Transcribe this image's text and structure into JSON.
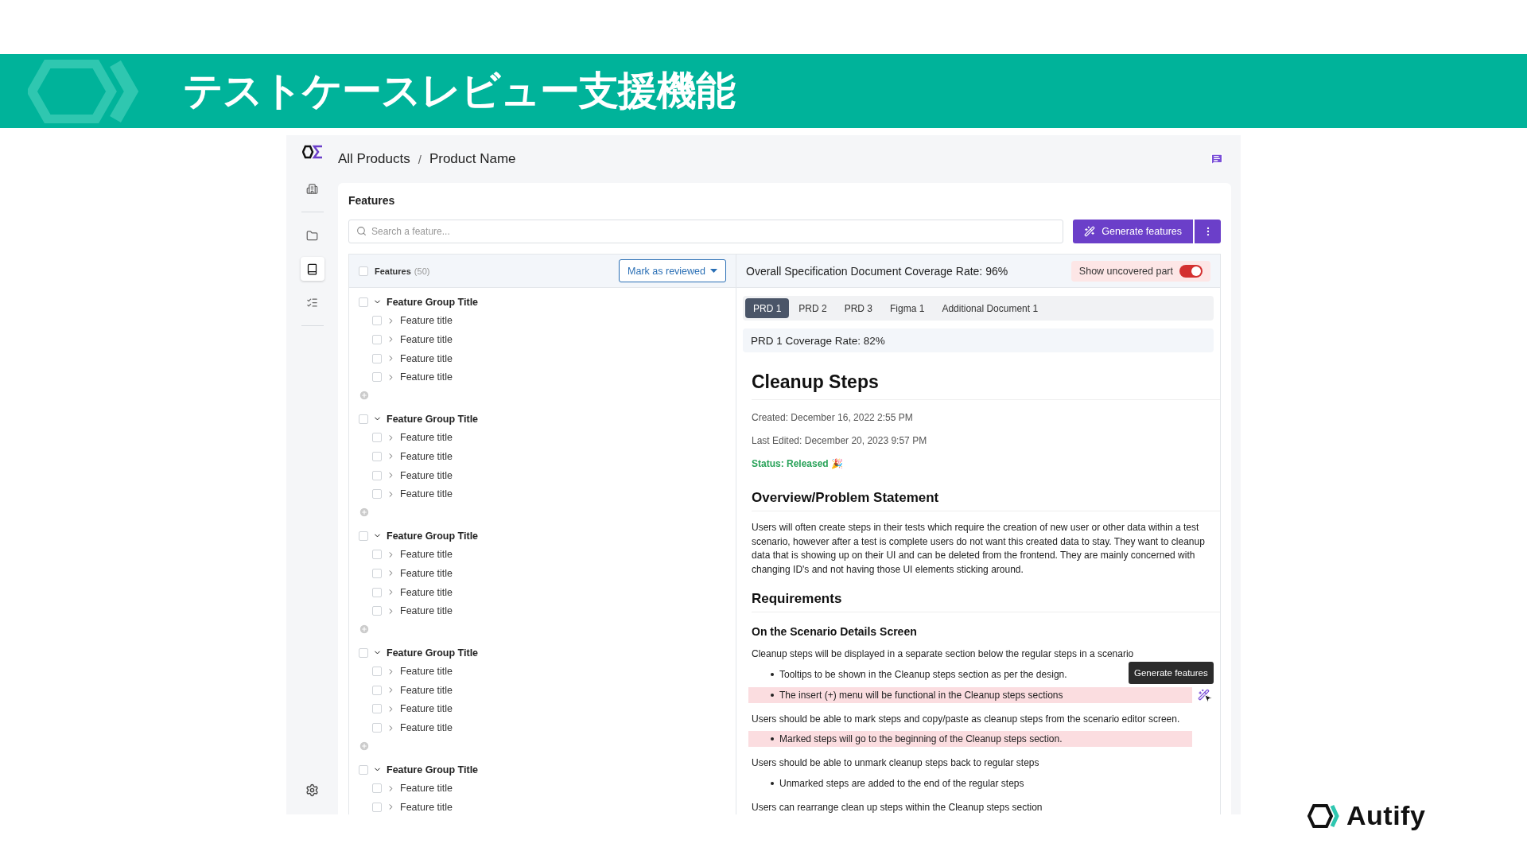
{
  "banner": {
    "title": "テストケースレビュー支援機能"
  },
  "app": {
    "breadcrumb": [
      "All Products",
      "Product Name"
    ],
    "breadcrumb_separator": "/",
    "sidebar_items": [
      {
        "kind": "building",
        "selected": false
      },
      {
        "kind": "folder",
        "selected": false
      },
      {
        "kind": "book",
        "selected": true
      },
      {
        "kind": "list",
        "selected": false
      }
    ],
    "features_title": "Features",
    "search_placeholder": "Search a feature...",
    "generate_button": "Generate features",
    "list_header": {
      "label": "Features",
      "count": "(50)",
      "checked": false,
      "action": "Mark as reviewed"
    },
    "groups": [
      {
        "title": "Feature Group Title",
        "checked": false,
        "expanded": true,
        "add_button": true,
        "children": [
          {
            "title": "Feature title",
            "checked": false
          },
          {
            "title": "Feature title",
            "checked": false
          },
          {
            "title": "Feature title",
            "checked": false
          },
          {
            "title": "Feature title",
            "checked": false
          }
        ]
      },
      {
        "title": "Feature Group Title",
        "checked": false,
        "expanded": true,
        "add_button": true,
        "children": [
          {
            "title": "Feature title",
            "checked": false
          },
          {
            "title": "Feature title",
            "checked": false
          },
          {
            "title": "Feature title",
            "checked": false
          },
          {
            "title": "Feature title",
            "checked": false
          }
        ]
      },
      {
        "title": "Feature Group Title",
        "checked": false,
        "expanded": true,
        "add_button": true,
        "children": [
          {
            "title": "Feature title",
            "checked": false
          },
          {
            "title": "Feature title",
            "checked": false
          },
          {
            "title": "Feature title",
            "checked": false
          },
          {
            "title": "Feature title",
            "checked": false
          }
        ]
      },
      {
        "title": "Feature Group Title",
        "checked": false,
        "expanded": true,
        "add_button": true,
        "children": [
          {
            "title": "Feature title",
            "checked": false
          },
          {
            "title": "Feature title",
            "checked": false
          },
          {
            "title": "Feature title",
            "checked": false
          },
          {
            "title": "Feature title",
            "checked": false
          }
        ]
      },
      {
        "title": "Feature Group Title",
        "checked": false,
        "expanded": true,
        "add_button": false,
        "children": [
          {
            "title": "Feature title",
            "checked": false
          },
          {
            "title": "Feature title",
            "checked": false
          }
        ]
      }
    ],
    "overall_coverage": "Overall Specification Document Coverage Rate: 96%",
    "toggle_label": "Show uncovered part",
    "toggle_on": true,
    "tabs": [
      {
        "label": "PRD 1",
        "selected": true
      },
      {
        "label": "PRD 2",
        "selected": false
      },
      {
        "label": "PRD 3",
        "selected": false
      },
      {
        "label": "Figma 1",
        "selected": false
      },
      {
        "label": "Additional Document 1",
        "selected": false
      }
    ],
    "doc_coverage": "PRD 1 Coverage Rate: 82%",
    "document": [
      {
        "kind": "h1",
        "text": "Cleanup Steps"
      },
      {
        "kind": "meta",
        "text": "Created: December 16, 2022 2:55 PM"
      },
      {
        "kind": "meta",
        "text": "Last Edited: December 20, 2023 9:57 PM"
      },
      {
        "kind": "status",
        "text": "Status: Released 🎉"
      },
      {
        "kind": "h2",
        "text": "Overview/Problem Statement"
      },
      {
        "kind": "p",
        "text": "Users will often create steps in their tests which require the creation of new user or other data within a test scenario, however after a test is complete users do not want this created data to stay. They want to cleanup data that is showing up on their UI and can be deleted from the frontend. They are mainly concerned with changing ID's and not having those UI elements sticking around."
      },
      {
        "kind": "h2",
        "text": "Requirements"
      },
      {
        "kind": "h3",
        "text": "On the Scenario Details Screen"
      },
      {
        "kind": "p",
        "text": "Cleanup steps will be displayed in a separate section below the regular steps in a scenario"
      },
      {
        "kind": "bullet",
        "text": "Tooltips to be shown in the Cleanup steps section as per the design.",
        "uncovered": false
      },
      {
        "kind": "bullet",
        "text": "The insert (+) menu will be functional in the Cleanup steps sections",
        "uncovered": true,
        "tooltip": "Generate features"
      },
      {
        "kind": "p",
        "text": "Users should be able to mark steps and copy/paste as cleanup steps from the scenario editor screen."
      },
      {
        "kind": "bullet",
        "text": "Marked steps will go to the beginning of the Cleanup steps section.",
        "uncovered": true
      },
      {
        "kind": "p",
        "text": "Users should be able to unmark cleanup steps back to regular steps"
      },
      {
        "kind": "bullet",
        "text": "Unmarked steps are added to the end of the regular steps",
        "uncovered": false
      },
      {
        "kind": "p",
        "text": "Users can rearrange clean up steps within the Cleanup steps section"
      }
    ]
  },
  "brand": {
    "name": "Autify"
  }
}
